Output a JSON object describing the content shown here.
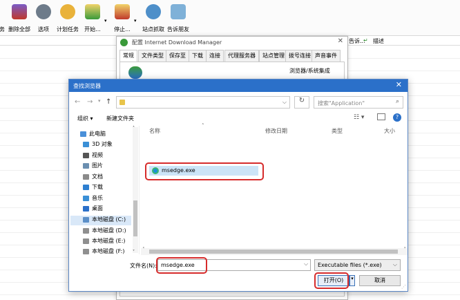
{
  "idm": {
    "toolbar": [
      {
        "label": "务"
      },
      {
        "label": "删除全部"
      },
      {
        "label": "选项"
      },
      {
        "label": "计划任务"
      },
      {
        "label": "开始..."
      },
      {
        "label": "停止..."
      },
      {
        "label": "站点抓取"
      },
      {
        "label": "告诉朋友"
      }
    ],
    "columns": {
      "last_try": "告诉...",
      "description": "描述"
    }
  },
  "config": {
    "title": "配置 Internet Download Manager",
    "tabs": [
      "常规",
      "文件类型",
      "保存至",
      "下载",
      "连接",
      "代理服务器",
      "站点管理",
      "拨号连接",
      "声音事件"
    ],
    "subtitle": "浏览器/系统集成"
  },
  "browse": {
    "title": "查找浏览器",
    "address_value": "",
    "search_placeholder": "搜索\"Application\"",
    "organize": "组织 ▾",
    "new_folder": "新建文件夹",
    "nav_items": [
      {
        "label": "此电脑",
        "color": "#4a90d9"
      },
      {
        "label": "3D 对象",
        "color": "#3a8fd6"
      },
      {
        "label": "视频",
        "color": "#555555"
      },
      {
        "label": "图片",
        "color": "#6b8fb0"
      },
      {
        "label": "文档",
        "color": "#8a8a8a"
      },
      {
        "label": "下载",
        "color": "#2e7fd0"
      },
      {
        "label": "音乐",
        "color": "#3a8fd6"
      },
      {
        "label": "桌面",
        "color": "#2b70c9"
      },
      {
        "label": "本地磁盘 (C:)",
        "color": "#5b8fc8"
      },
      {
        "label": "本地磁盘 (D:)",
        "color": "#8f8f8f"
      },
      {
        "label": "本地磁盘 (E:)",
        "color": "#8f8f8f"
      },
      {
        "label": "本地磁盘 (F:)",
        "color": "#8f8f8f"
      }
    ],
    "columns": {
      "name": "名称",
      "modified": "修改日期",
      "type": "类型",
      "size": "大小"
    },
    "file_name": "msedge.exe",
    "filename_label": "文件名(N):",
    "filename_value": "msedge.exe",
    "filetype_value": "Executable files (*.exe)",
    "open_label": "打开(O)",
    "cancel_label": "取消"
  }
}
